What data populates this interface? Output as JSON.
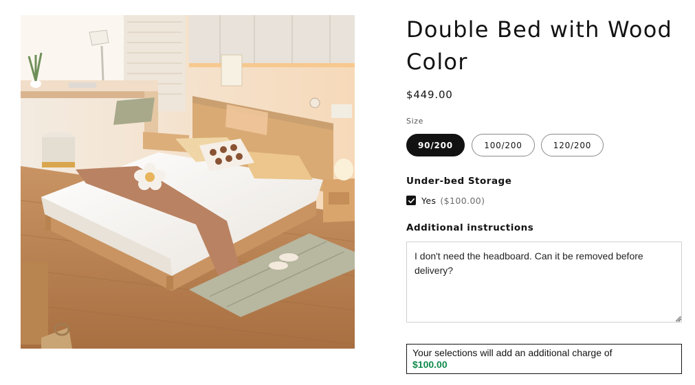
{
  "product": {
    "image_alt": "Double bed with wooden headboard in a bright bedroom",
    "title": "Double Bed with Wood Color",
    "price": "$449.00"
  },
  "size": {
    "label": "Size",
    "options": [
      "90/200",
      "100/200",
      "120/200"
    ],
    "selected": "90/200"
  },
  "storage": {
    "label": "Under-bed Storage",
    "option_label": "Yes",
    "option_extra": "($100.00)",
    "checked": true
  },
  "instructions": {
    "label": "Additional instructions",
    "value": "I don't need the headboard. Can it be removed before delivery?"
  },
  "charge": {
    "text": "Your selections will add an additional charge of",
    "amount": "$100.00"
  },
  "colors": {
    "selected_pill": "#121212",
    "charge_green": "#108a4c"
  }
}
